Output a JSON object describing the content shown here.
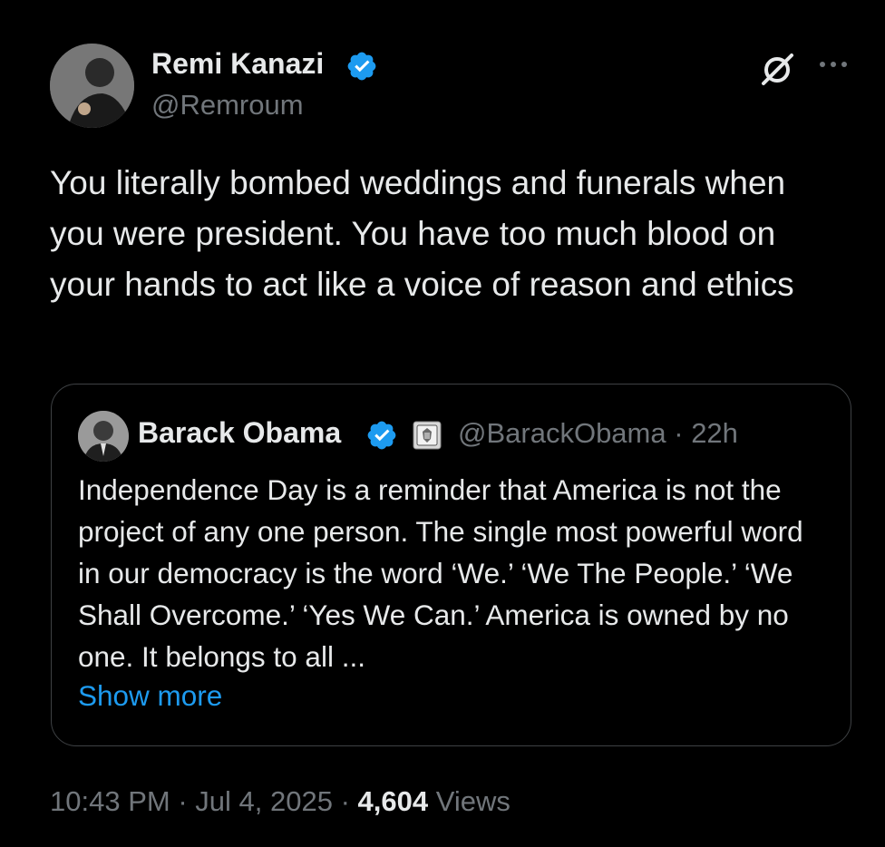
{
  "tweet": {
    "author_name": "Remi Kanazi",
    "author_handle": "@Remroum",
    "text": "You literally bombed weddings and funerals when you were president. You have too much blood on your hands to act like a voice of reason and ethics"
  },
  "quoted_tweet": {
    "author_name": "Barack Obama",
    "author_handle": "@BarackObama",
    "separator": "·",
    "time_ago": "22h",
    "text": "Independence Day is a reminder that America is not the project of any one person. The single most powerful word in our democracy is the word ‘We.’ ‘We The People.’ ‘We Shall Overcome.’ ‘Yes We Can.’ America is owned by no one. It belongs to all ...",
    "show_more_label": "Show more"
  },
  "footer": {
    "time": "10:43 PM",
    "sep1": "·",
    "date": "Jul 4, 2025",
    "sep2": "·",
    "views_count": "4,604",
    "views_label": "Views"
  },
  "icons": {
    "verified": "verified-badge-icon",
    "grok": "grok-icon",
    "more": "more-options-icon",
    "affiliation": "us-seal-icon"
  },
  "colors": {
    "background": "#000000",
    "primary_text": "#e7e9ea",
    "secondary_text": "#71767b",
    "accent": "#1d9bf0",
    "border": "#3e4144"
  }
}
